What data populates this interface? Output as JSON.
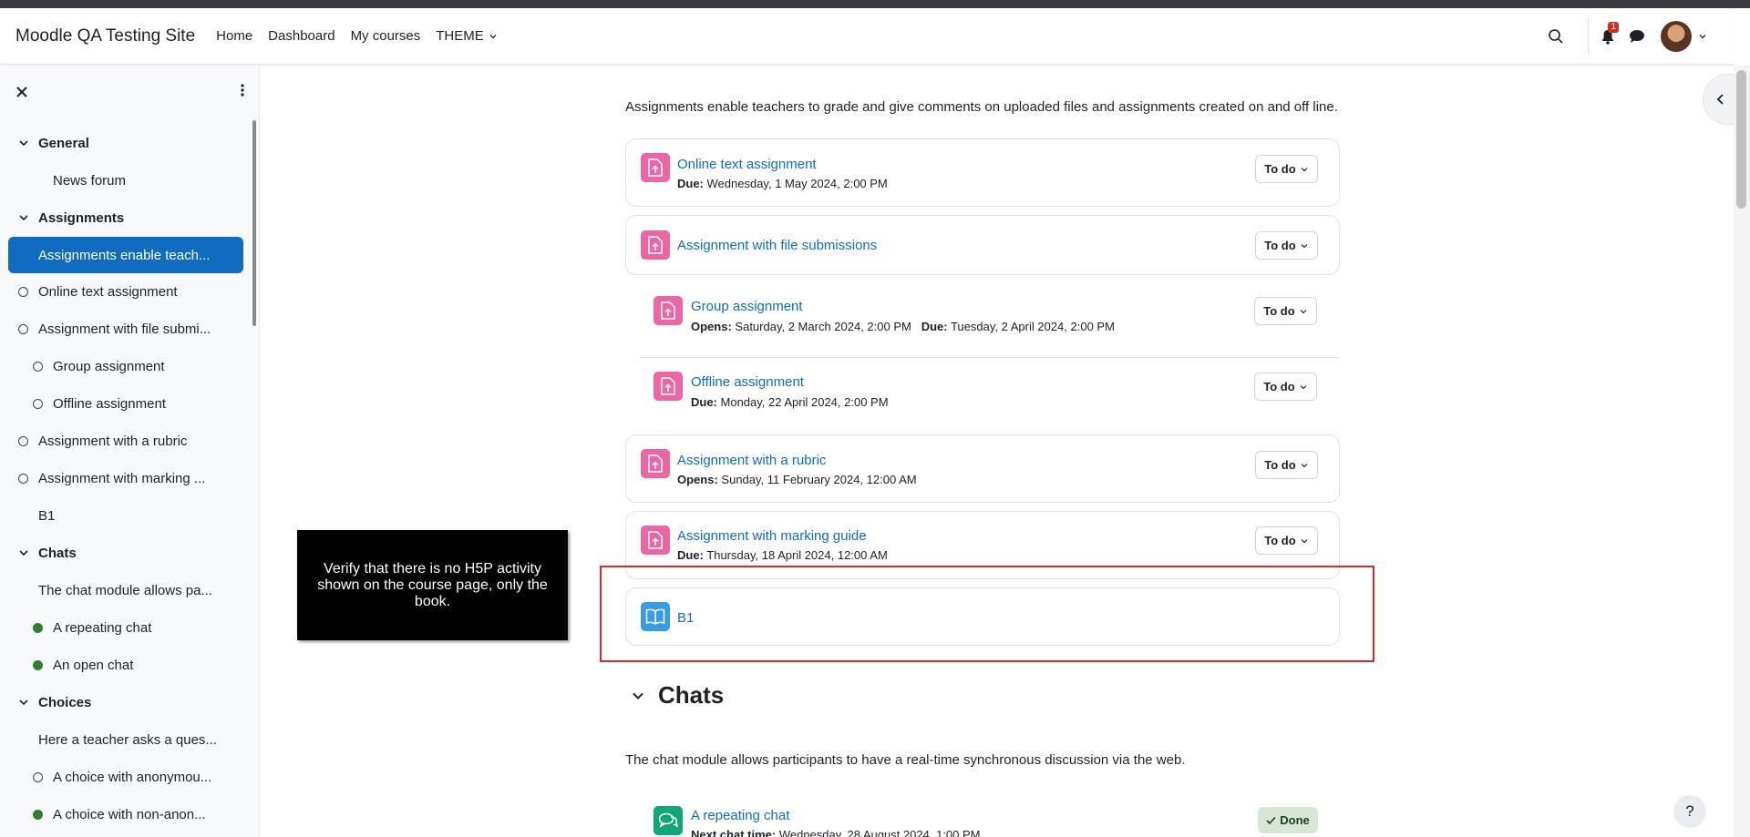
{
  "navbar": {
    "site_name": "Moodle QA Testing Site",
    "links": [
      "Home",
      "Dashboard",
      "My courses",
      "THEME"
    ],
    "notification_count": "1"
  },
  "drawer": {
    "items": [
      {
        "label": "General",
        "kind": "section"
      },
      {
        "label": "News forum",
        "kind": "plain1"
      },
      {
        "label": "Assignments",
        "kind": "section"
      },
      {
        "label": "Assignments enable teach...",
        "kind": "active"
      },
      {
        "label": "Online text assignment",
        "kind": "dot0"
      },
      {
        "label": "Assignment with file submi...",
        "kind": "dot0"
      },
      {
        "label": "Group assignment",
        "kind": "dot1"
      },
      {
        "label": "Offline assignment",
        "kind": "dot1"
      },
      {
        "label": "Assignment with a rubric",
        "kind": "dot0"
      },
      {
        "label": "Assignment with marking ...",
        "kind": "dot0"
      },
      {
        "label": "B1",
        "kind": "plain0"
      },
      {
        "label": "Chats",
        "kind": "section"
      },
      {
        "label": "The chat module allows pa...",
        "kind": "plain0"
      },
      {
        "label": "A repeating chat",
        "kind": "done1"
      },
      {
        "label": "An open chat",
        "kind": "done1"
      },
      {
        "label": "Choices",
        "kind": "section"
      },
      {
        "label": "Here a teacher asks a ques...",
        "kind": "plain0"
      },
      {
        "label": "A choice with anonymou...",
        "kind": "dot1"
      },
      {
        "label": "A choice with non-anon...",
        "kind": "done1"
      }
    ]
  },
  "main": {
    "assignments_desc": "Assignments enable teachers to grade and give comments on uploaded files and assignments created on and off line.",
    "todo_label": "To do",
    "done_label": "Done",
    "activities": [
      {
        "title": "Online text assignment",
        "date_label": "Due:",
        "date": "Wednesday, 1 May 2024, 2:00 PM"
      },
      {
        "title": "Assignment with file submissions"
      },
      {
        "title": "Group assignment",
        "date_label": "Opens:",
        "date": "Saturday, 2 March 2024, 2:00 PM",
        "date2_label": "Due:",
        "date2": "Tuesday, 2 April 2024, 2:00 PM"
      },
      {
        "title": "Offline assignment",
        "date_label": "Due:",
        "date": "Monday, 22 April 2024, 2:00 PM"
      },
      {
        "title": "Assignment with a rubric",
        "date_label": "Opens:",
        "date": "Sunday, 11 February 2024, 12:00 AM"
      },
      {
        "title": "Assignment with marking guide",
        "date_label": "Due:",
        "date": "Thursday, 18 April 2024, 12:00 AM"
      },
      {
        "title": "B1"
      }
    ],
    "chats_title": "Chats",
    "chats_desc": "The chat module allows participants to have a real-time synchronous discussion via the web.",
    "chat_activity": {
      "title": "A repeating chat",
      "date_label": "Next chat time:",
      "date": "Wednesday, 28 August 2024, 1:00 PM"
    }
  },
  "callout": "Verify that there is no H5P activity shown on the course page, only the book.",
  "help": "?"
}
